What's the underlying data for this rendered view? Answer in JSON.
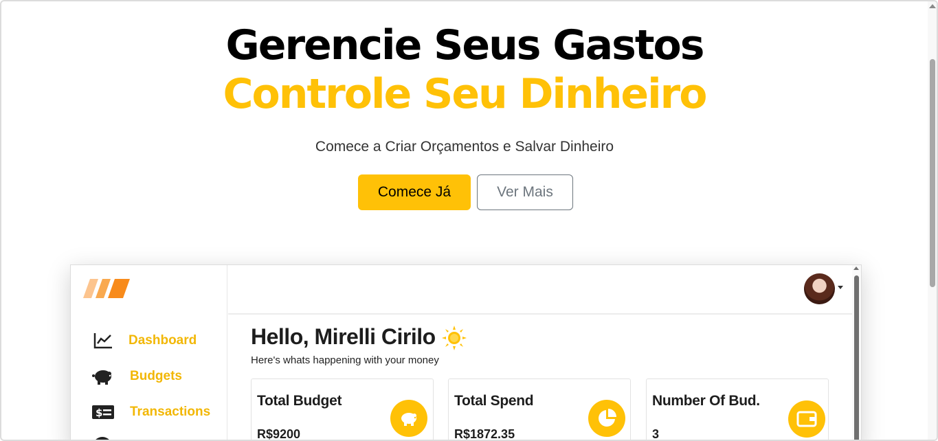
{
  "hero": {
    "title": "Gerencie Seus Gastos",
    "subtitle": "Controle Seu Dinheiro",
    "tagline": "Comece a Criar Orçamentos e Salvar Dinheiro",
    "primary_button": "Comece Já",
    "secondary_button": "Ver Mais"
  },
  "preview": {
    "sidebar": {
      "items": [
        {
          "label": "Dashboard",
          "icon": "chart-line-icon"
        },
        {
          "label": "Budgets",
          "icon": "piggy-bank-icon"
        },
        {
          "label": "Transactions",
          "icon": "money-bill-icon"
        }
      ]
    },
    "greeting": "Hello, Mirelli Cirilo",
    "greeting_sub": "Here's whats happening with your money",
    "cards": [
      {
        "title": "Total Budget",
        "value": "R$9200",
        "icon": "piggy-bank-icon"
      },
      {
        "title": "Total Spend",
        "value": "R$1872.35",
        "icon": "pie-chart-icon"
      },
      {
        "title": "Number Of Bud.",
        "value": "3",
        "icon": "wallet-icon"
      }
    ]
  },
  "colors": {
    "accent": "#ffc107",
    "sidebar_label": "#f2b705",
    "secondary_button": "#6c757d"
  }
}
